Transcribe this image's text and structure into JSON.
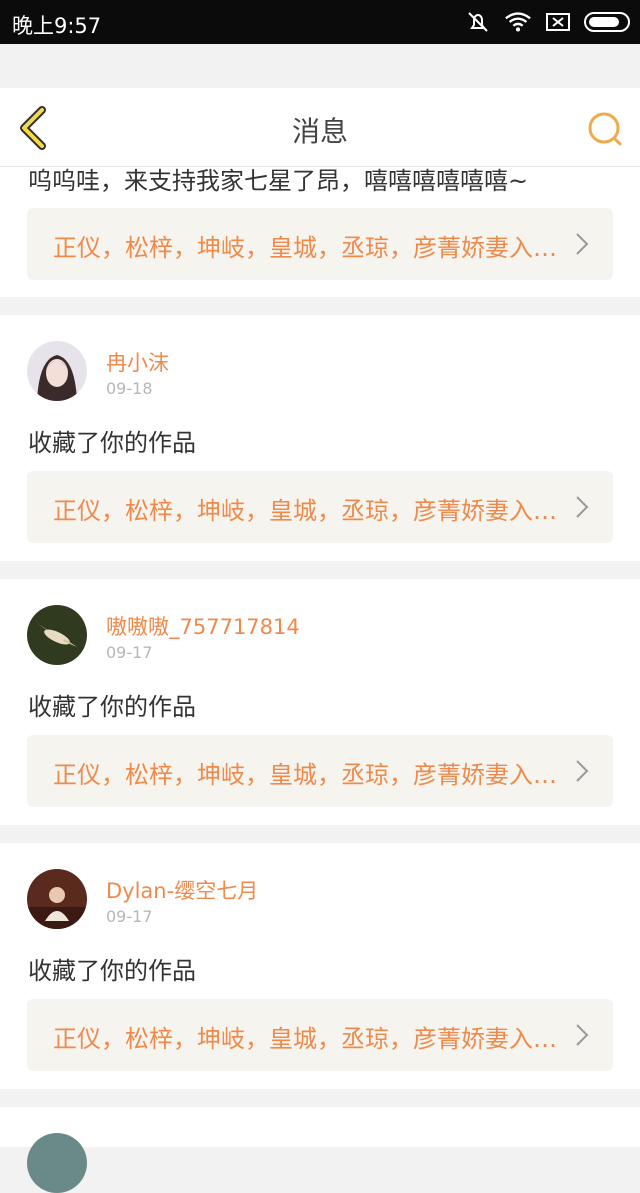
{
  "status_bar": {
    "time": "晚上9:57"
  },
  "header": {
    "title": "消息",
    "accent_color": "#f0a94b"
  },
  "partial_top_card": {
    "text": "呜呜哇，来支持我家七星了昂，嘻嘻嘻嘻嘻嘻~",
    "work_title": "正仪，松梓，坤岐，皇城，丞琼，彦菁娇妻入…"
  },
  "messages": [
    {
      "username": "冉小沫",
      "date": "09-18",
      "action": "收藏了你的作品",
      "work_title": "正仪，松梓，坤岐，皇城，丞琼，彦菁娇妻入…"
    },
    {
      "username": "嗷嗷嗷_757717814",
      "date": "09-17",
      "action": "收藏了你的作品",
      "work_title": "正仪，松梓，坤岐，皇城，丞琼，彦菁娇妻入…"
    },
    {
      "username": "Dylan-缨空七月",
      "date": "09-17",
      "action": "收藏了你的作品",
      "work_title": "正仪，松梓，坤岐，皇城，丞琼，彦菁娇妻入…"
    }
  ],
  "colors": {
    "username": "#f08a4b",
    "work_title": "#f08a4b",
    "work_box_bg": "#f5f4ef"
  }
}
